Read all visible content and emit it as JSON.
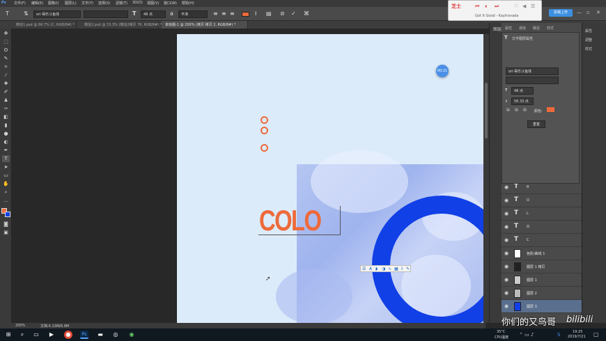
{
  "menu": [
    "文件(F)",
    "编辑(E)",
    "图像(I)",
    "图层(L)",
    "文字(Y)",
    "选择(S)",
    "滤镜(T)",
    "3D(D)",
    "视图(V)",
    "窗口(W)",
    "帮助(H)"
  ],
  "options": {
    "font_family": "ori·得乐斗鱼体",
    "font_style": "",
    "font_size": "48 点",
    "antialias": "平滑"
  },
  "tabs": [
    {
      "label": "微信1.psd @ 66.7% (C, RGB/8#) *"
    },
    {
      "label": "微信2.psd @ 33.3% (微信2拷贝 76, RGB/8#) *"
    },
    {
      "label": "未标题-1 @ 200% (拷贝 拷贝 2, RGB/8#) *",
      "active": true
    }
  ],
  "canvas": {
    "headline": "COLO",
    "timer_badge": "00:21",
    "accent": "#ee6a3b",
    "blue": "#1140e6"
  },
  "music_player": {
    "logo": "芝士",
    "line1": "Got It Good - Kaytranada"
  },
  "upload_button": "投稿上传",
  "panel_tabs": [
    "图层",
    "属性",
    "通道",
    "路径",
    "样式"
  ],
  "properties": {
    "title": "文字图层属性",
    "font_family": "ori·得乐斗鱼体",
    "size": "48 点",
    "leading": "56.33 点",
    "color_label": "颜色:",
    "reset_label": "重置"
  },
  "right_dock": [
    "属性",
    "调整",
    "样式"
  ],
  "layers": [
    {
      "type": "text",
      "name": "R"
    },
    {
      "type": "text",
      "name": "O"
    },
    {
      "type": "text",
      "name": "L"
    },
    {
      "type": "text",
      "name": "O"
    },
    {
      "type": "text",
      "name": "C"
    },
    {
      "type": "thumb",
      "name": "色阶/曲线 1"
    },
    {
      "type": "thumb",
      "name": "图层 1 拷贝"
    },
    {
      "type": "thumb",
      "name": "图层 1"
    },
    {
      "type": "thumb",
      "name": "图层 2"
    },
    {
      "type": "blue",
      "name": "图层 3",
      "selected": true
    }
  ],
  "status": {
    "zoom": "200%",
    "doc": "文档:4.13M/6.9M"
  },
  "taskbar": {
    "temp": "35°C",
    "cpu": "CPU温度",
    "time": "19:25",
    "date": "2019/7/21"
  },
  "watermark": "你们的又鸟哥",
  "bilibili": "bilibili"
}
